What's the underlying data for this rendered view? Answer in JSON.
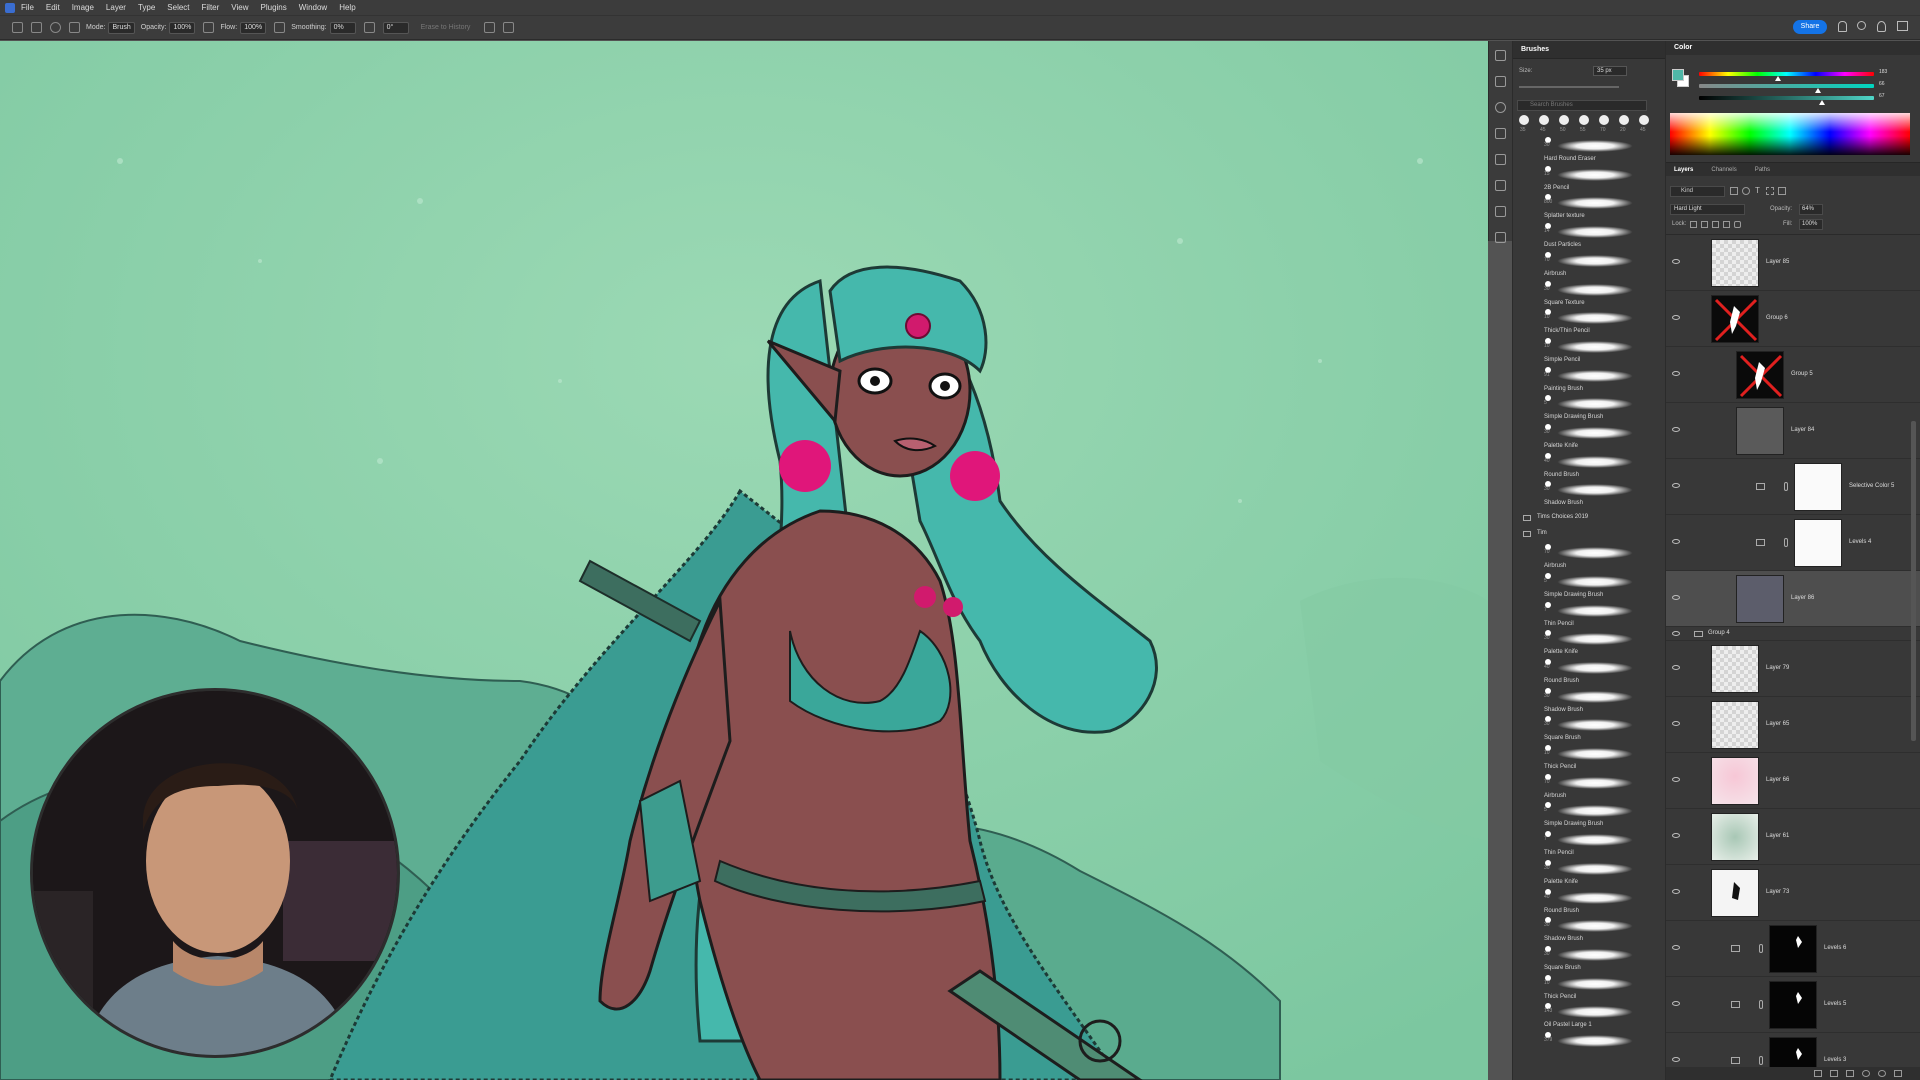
{
  "menubar": {
    "items": [
      "File",
      "Edit",
      "Image",
      "Layer",
      "Type",
      "Select",
      "Filter",
      "View",
      "Plugins",
      "Window",
      "Help"
    ]
  },
  "options": {
    "mode_label": "Mode:",
    "mode_value": "Brush",
    "opacity_label": "Opacity:",
    "opacity_value": "100%",
    "flow_label": "Flow:",
    "flow_value": "100%",
    "smoothing_label": "Smoothing:",
    "smoothing_value": "0%",
    "angle_value": "0°",
    "erase_to_history": "Erase to History",
    "share_label": "Share"
  },
  "brushes_panel": {
    "title": "Brushes",
    "size_label": "Size:",
    "size_value": "35 px",
    "search_placeholder": "Search Brushes",
    "presets": [
      "35",
      "45",
      "50",
      "55",
      "70",
      "20",
      "45"
    ],
    "items": [
      {
        "name": "Hard Round Eraser",
        "size": "30"
      },
      {
        "name": "2B Pencil",
        "size": "15"
      },
      {
        "name": "Splatter texture",
        "size": "800"
      },
      {
        "name": "Dust Particles",
        "size": "14"
      },
      {
        "name": "Airbrush",
        "size": "70"
      },
      {
        "name": "Square Texture",
        "size": "30"
      },
      {
        "name": "Thick/Thin Pencil",
        "size": "10"
      },
      {
        "name": "Simple Pencil",
        "size": "10"
      },
      {
        "name": "Painting Brush",
        "size": "91"
      },
      {
        "name": "Simple Drawing Brush",
        "size": "5"
      },
      {
        "name": "Palette Knife",
        "size": "30"
      },
      {
        "name": "Round Brush",
        "size": "40"
      },
      {
        "name": "Shadow Brush",
        "size": "30"
      }
    ],
    "group1": "Tims Choices 2019",
    "group2": "Tim",
    "items2": [
      {
        "name": "Airbrush",
        "size": "70"
      },
      {
        "name": "Simple Drawing Brush",
        "size": "5"
      },
      {
        "name": "Thin Pencil",
        "size": "7"
      },
      {
        "name": "Palette Knife",
        "size": "30"
      },
      {
        "name": "Round Brush",
        "size": "40"
      },
      {
        "name": "Shadow Brush",
        "size": "30"
      },
      {
        "name": "Square Brush",
        "size": "30"
      },
      {
        "name": "Thick Pencil",
        "size": "10"
      },
      {
        "name": "Airbrush",
        "size": "70"
      },
      {
        "name": "Simple Drawing Brush",
        "size": "5"
      },
      {
        "name": "Thin Pencil",
        "size": "7"
      },
      {
        "name": "Palette Knife",
        "size": "30"
      },
      {
        "name": "Round Brush",
        "size": "40"
      },
      {
        "name": "Shadow Brush",
        "size": "30"
      },
      {
        "name": "Square Brush",
        "size": "30"
      },
      {
        "name": "Thick Pencil",
        "size": "10"
      },
      {
        "name": "Oil Pastel Large 1",
        "size": "143"
      },
      {
        "name": "",
        "size": "379"
      }
    ]
  },
  "color_panel": {
    "title": "Color",
    "values": [
      "183",
      "66",
      "67"
    ],
    "slider_levels": [
      0.45,
      0.68,
      0.7
    ],
    "foreground": "#4fb8a8"
  },
  "layers_panel": {
    "tabs": [
      "Layers",
      "Channels",
      "Paths"
    ],
    "kind_placeholder": "Kind",
    "blend_mode": "Hard Light",
    "opacity_label": "Opacity:",
    "opacity_value": "64%",
    "lock_label": "Lock:",
    "fill_label": "Fill:",
    "fill_value": "100%",
    "layers": [
      {
        "name": "Layer 85",
        "type": "checker"
      },
      {
        "name": "Group 6",
        "type": "group-red"
      },
      {
        "name": "Group 5",
        "type": "group-red"
      },
      {
        "name": "Layer 84",
        "type": "gray"
      },
      {
        "name": "Selective Color 5",
        "type": "white"
      },
      {
        "name": "Levels 4",
        "type": "white"
      },
      {
        "name": "Layer 86",
        "type": "dark",
        "selected": true
      },
      {
        "name": "Group 4",
        "type": "group-header"
      },
      {
        "name": "Layer 79",
        "type": "checker"
      },
      {
        "name": "Layer 65",
        "type": "checker"
      },
      {
        "name": "Layer 66",
        "type": "pink"
      },
      {
        "name": "Layer 61",
        "type": "green"
      },
      {
        "name": "Layer 73",
        "type": "figure"
      },
      {
        "name": "Levels 6",
        "type": "black"
      },
      {
        "name": "Levels 5",
        "type": "black"
      },
      {
        "name": "Levels 3",
        "type": "black"
      }
    ]
  }
}
